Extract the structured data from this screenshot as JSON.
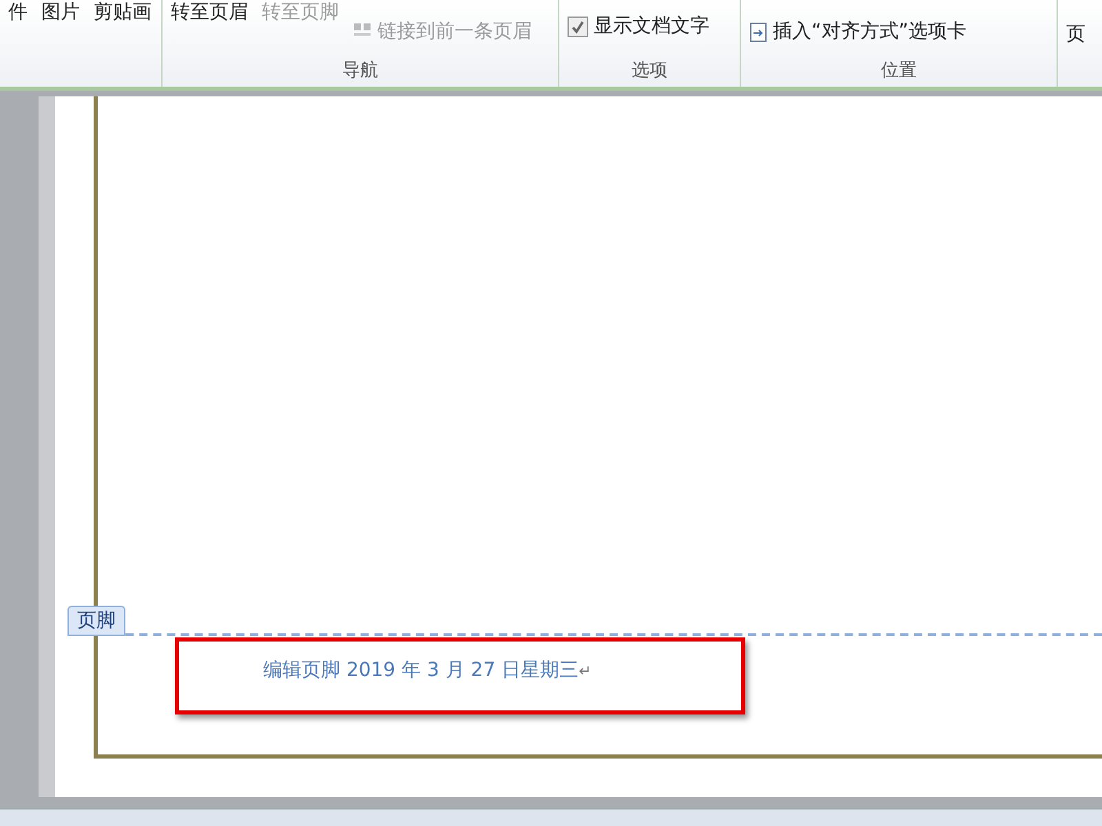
{
  "ribbon": {
    "insert_items": [
      "件",
      "图片",
      "剪贴画"
    ],
    "navigation": {
      "buttons": [
        {
          "label": "转至页眉",
          "disabled": false
        },
        {
          "label": "转至页脚",
          "disabled": true
        }
      ],
      "link_button": {
        "label": "链接到前一条页眉",
        "disabled": true
      },
      "group_label": "导航"
    },
    "options": {
      "checkbox": {
        "label": "显示文档文字",
        "checked": true
      },
      "group_label": "选项"
    },
    "position": {
      "insert_tab_button": "插入“对齐方式”选项卡",
      "group_label": "位置"
    },
    "next_group_label": "页"
  },
  "document": {
    "footer_tab": "页脚",
    "footer_text": "编辑页脚 2019 年 3 月 27 日星期三",
    "paragraph_mark": "↵"
  }
}
